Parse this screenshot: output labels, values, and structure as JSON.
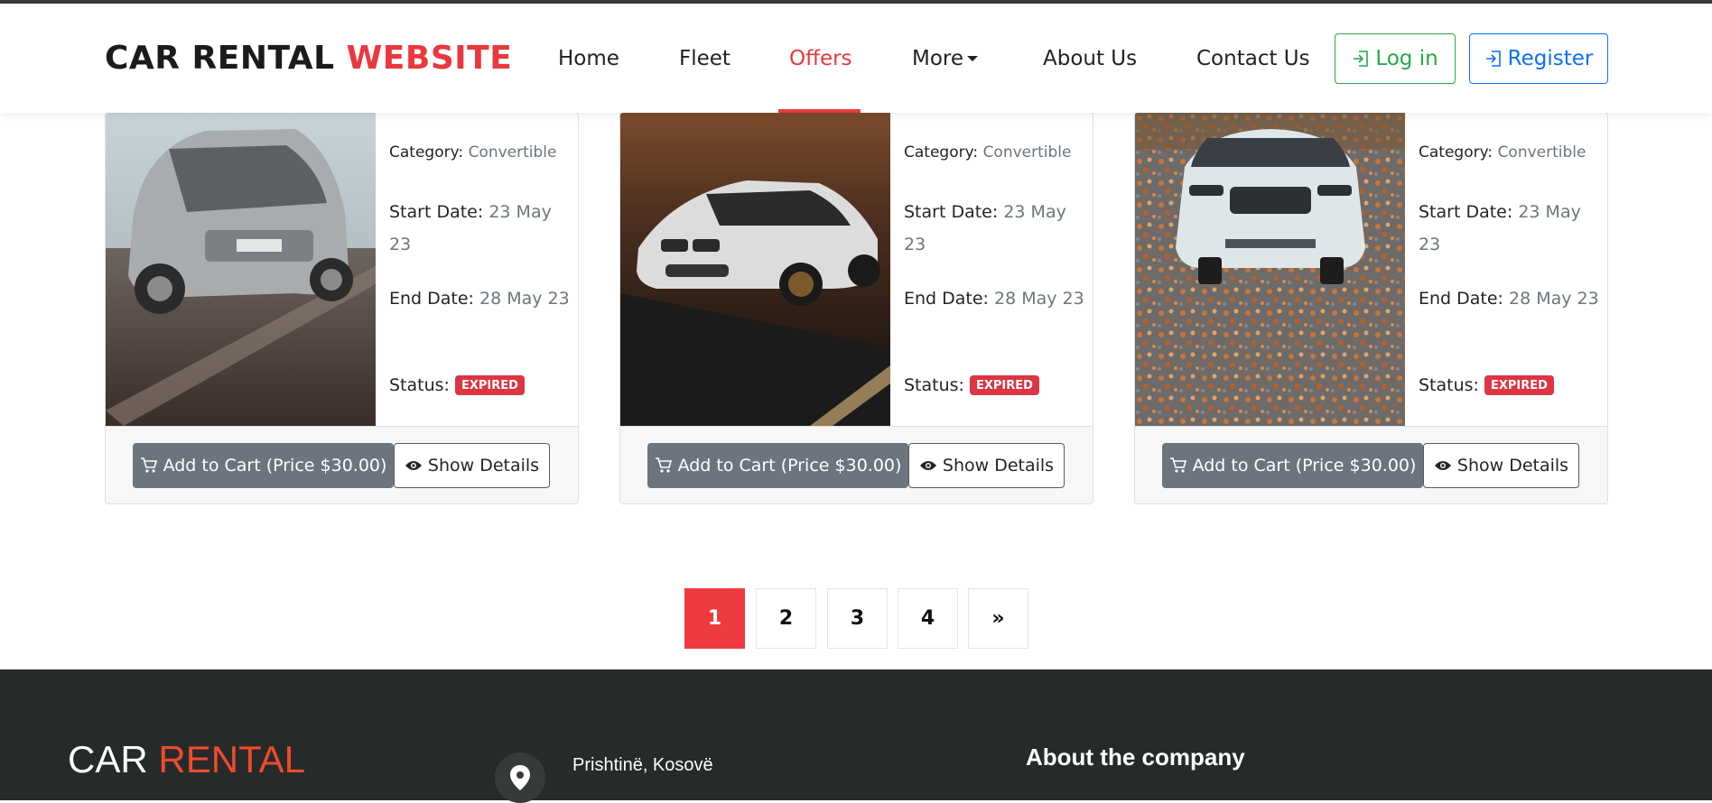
{
  "brand": {
    "part1": "CAR RENTAL",
    "part2": "WEBSITE"
  },
  "nav": {
    "home": "Home",
    "fleet": "Fleet",
    "offers": "Offers",
    "more": "More",
    "about": "About Us",
    "contact": "Contact Us",
    "login": "Log in",
    "register": "Register",
    "active": "Offers"
  },
  "cards": [
    {
      "category_label": "Category:",
      "category": "Convertible",
      "start_label": "Start Date:",
      "start": "23 May 23",
      "end_label": "End Date:",
      "end": "28 May 23",
      "status_label": "Status:",
      "status": "EXPIRED",
      "cart_label": "Add to Cart (Price $30.00)",
      "details_label": "Show Details"
    },
    {
      "category_label": "Category:",
      "category": "Convertible",
      "start_label": "Start Date:",
      "start": "23 May 23",
      "end_label": "End Date:",
      "end": "28 May 23",
      "status_label": "Status:",
      "status": "EXPIRED",
      "cart_label": "Add to Cart (Price $30.00)",
      "details_label": "Show Details"
    },
    {
      "category_label": "Category:",
      "category": "Convertible",
      "start_label": "Start Date:",
      "start": "23 May 23",
      "end_label": "End Date:",
      "end": "28 May 23",
      "status_label": "Status:",
      "status": "EXPIRED",
      "cart_label": "Add to Cart (Price $30.00)",
      "details_label": "Show Details"
    }
  ],
  "pagination": {
    "pages": [
      "1",
      "2",
      "3",
      "4"
    ],
    "next": "»",
    "current": "1"
  },
  "footer": {
    "brand1": "CAR",
    "brand2": "RENTAL",
    "address": "Prishtinë, Kosovë",
    "about_heading": "About the company"
  },
  "colors": {
    "accent": "#e9383f",
    "login": "#28a745",
    "register": "#0d6efd",
    "badge": "#dc3545",
    "footer_bg": "#272a2a"
  },
  "icons": {
    "cart": "cart-icon",
    "details": "eye-icon",
    "login": "login-icon",
    "register": "register-icon",
    "location": "location-pin-icon"
  }
}
